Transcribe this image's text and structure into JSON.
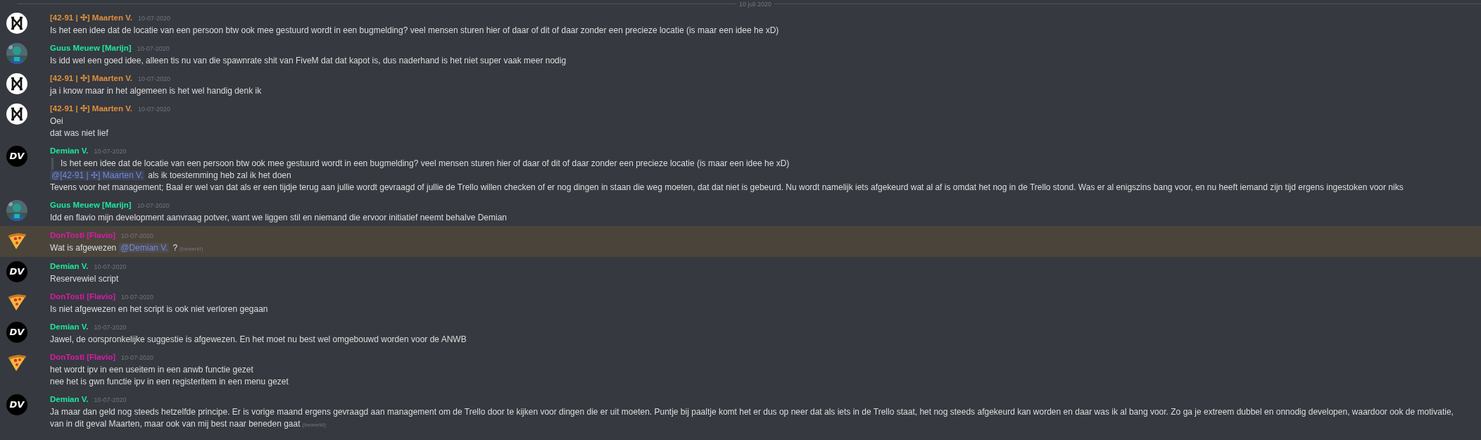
{
  "divider": {
    "label": "10 juli 2020"
  },
  "messages": [
    {
      "author": "[42-91 | ✣] Maarten V.",
      "color": "#e1903d",
      "timestamp": "10-07-2020",
      "avatar": {
        "kind": "logo"
      },
      "highlighted": false,
      "lines": [
        {
          "kind": "text",
          "parts": [
            {
              "kind": "plain",
              "text": "Is het een idee dat de locatie van een persoon btw ook mee gestuurd wordt in een bugmelding? veel mensen sturen hier of daar of dit of daar zonder een precieze locatie (is maar een idee he xD)"
            }
          ]
        }
      ]
    },
    {
      "author": "Guus Meuew [Marijn]",
      "color": "#1ee8a0",
      "timestamp": "10-07-2020",
      "avatar": {
        "kind": "picture"
      },
      "highlighted": false,
      "lines": [
        {
          "kind": "text",
          "parts": [
            {
              "kind": "plain",
              "text": "Is idd wel een goed idee, alleen tis nu van die spawnrate shit van FiveM dat dat kapot is, dus naderhand is het niet super vaak meer nodig"
            }
          ]
        }
      ]
    },
    {
      "author": "[42-91 | ✣] Maarten V.",
      "color": "#e1903d",
      "timestamp": "10-07-2020",
      "avatar": {
        "kind": "logo"
      },
      "highlighted": false,
      "lines": [
        {
          "kind": "text",
          "parts": [
            {
              "kind": "plain",
              "text": "ja i know maar in het algemeen is het wel handig denk ik"
            }
          ]
        }
      ]
    },
    {
      "author": "[42-91 | ✣] Maarten V.",
      "color": "#e1903d",
      "timestamp": "10-07-2020",
      "avatar": {
        "kind": "logo"
      },
      "highlighted": false,
      "lines": [
        {
          "kind": "text",
          "parts": [
            {
              "kind": "plain",
              "text": "Oei"
            }
          ]
        },
        {
          "kind": "text",
          "parts": [
            {
              "kind": "plain",
              "text": "dat was niet lief"
            }
          ]
        }
      ]
    },
    {
      "author": "Demian V.",
      "color": "#1ee8a0",
      "timestamp": "10-07-2020",
      "avatar": {
        "kind": "initials",
        "text": "DV"
      },
      "highlighted": false,
      "lines": [
        {
          "kind": "quote",
          "parts": [
            {
              "kind": "plain",
              "text": "Is het een idee dat de locatie van een persoon btw ook mee gestuurd wordt in een bugmelding? veel mensen sturen hier of daar of dit of daar zonder een precieze locatie (is maar een idee he xD)"
            }
          ]
        },
        {
          "kind": "text",
          "parts": [
            {
              "kind": "mention",
              "text": "@[42-91 | ✣] Maarten V."
            },
            {
              "kind": "plain",
              "text": "als ik toestemming heb zal ik het doen"
            }
          ]
        },
        {
          "kind": "text",
          "parts": [
            {
              "kind": "plain",
              "text": "Tevens voor het management; Baal er wel van dat als er een tijdje terug aan jullie wordt gevraagd of jullie de Trello willen checken of er nog dingen in staan die weg moeten, dat dat niet is gebeurd. Nu wordt namelijk iets afgekeurd wat al af is omdat het nog in de Trello stond. Was er al enigszins bang voor, en nu heeft iemand zijn tijd ergens ingestoken voor niks"
            }
          ]
        }
      ]
    },
    {
      "author": "Guus Meuew [Marijn]",
      "color": "#1ee8a0",
      "timestamp": "10-07-2020",
      "avatar": {
        "kind": "picture"
      },
      "highlighted": false,
      "lines": [
        {
          "kind": "text",
          "parts": [
            {
              "kind": "plain",
              "text": "Idd en flavio mijn development aanvraag potver, want we liggen stil en niemand die ervoor initiatief neemt behalve Demian"
            }
          ]
        }
      ]
    },
    {
      "author": "DonTosti [Flavio]",
      "color": "#d91aa8",
      "timestamp": "10-07-2020",
      "avatar": {
        "kind": "pizza"
      },
      "highlighted": true,
      "lines": [
        {
          "kind": "text",
          "parts": [
            {
              "kind": "plain",
              "text": "Wat is afgewezen"
            },
            {
              "kind": "mention",
              "text": "@Demian V."
            },
            {
              "kind": "plain",
              "text": "?"
            }
          ],
          "edited": "(bewerkt)"
        }
      ]
    },
    {
      "author": "Demian V.",
      "color": "#1ee8a0",
      "timestamp": "10-07-2020",
      "avatar": {
        "kind": "initials",
        "text": "DV"
      },
      "highlighted": false,
      "lines": [
        {
          "kind": "text",
          "parts": [
            {
              "kind": "plain",
              "text": "Reservewiel script"
            }
          ]
        }
      ]
    },
    {
      "author": "DonTosti [Flavio]",
      "color": "#d91aa8",
      "timestamp": "10-07-2020",
      "avatar": {
        "kind": "pizza"
      },
      "highlighted": false,
      "lines": [
        {
          "kind": "text",
          "parts": [
            {
              "kind": "plain",
              "text": "Is niet afgewezen en het script is ook niet verloren gegaan"
            }
          ]
        }
      ]
    },
    {
      "author": "Demian V.",
      "color": "#1ee8a0",
      "timestamp": "10-07-2020",
      "avatar": {
        "kind": "initials",
        "text": "DV"
      },
      "highlighted": false,
      "lines": [
        {
          "kind": "text",
          "parts": [
            {
              "kind": "plain",
              "text": "Jawel, de oorspronkelijke suggestie is afgewezen. En het moet nu best wel omgebouwd worden voor de ANWB"
            }
          ]
        }
      ]
    },
    {
      "author": "DonTosti [Flavio]",
      "color": "#d91aa8",
      "timestamp": "10-07-2020",
      "avatar": {
        "kind": "pizza"
      },
      "highlighted": false,
      "lines": [
        {
          "kind": "text",
          "parts": [
            {
              "kind": "plain",
              "text": "het wordt ipv in een useitem in een anwb functie gezet"
            }
          ]
        },
        {
          "kind": "text",
          "parts": [
            {
              "kind": "plain",
              "text": "nee het is gwn functie ipv in een registeritem in een menu gezet"
            }
          ]
        }
      ]
    },
    {
      "author": "Demian V.",
      "color": "#1ee8a0",
      "timestamp": "10-07-2020",
      "avatar": {
        "kind": "initials",
        "text": "DV"
      },
      "highlighted": false,
      "lines": [
        {
          "kind": "text",
          "parts": [
            {
              "kind": "plain",
              "text": "Ja maar dan geld nog steeds hetzelfde principe. Er is vorige maand ergens gevraagd aan management om de Trello door te kijken voor dingen die er uit moeten. Puntje bij paaltje komt het er dus op neer dat als iets in de Trello staat, het nog steeds afgekeurd kan worden en daar was ik al bang voor. Zo ga je extreem dubbel en onnodig developen, waardoor ook de motivatie, van in dit geval Maarten, maar ook van mij best naar beneden gaat"
            }
          ],
          "edited": "(bewerkt)"
        }
      ]
    }
  ]
}
